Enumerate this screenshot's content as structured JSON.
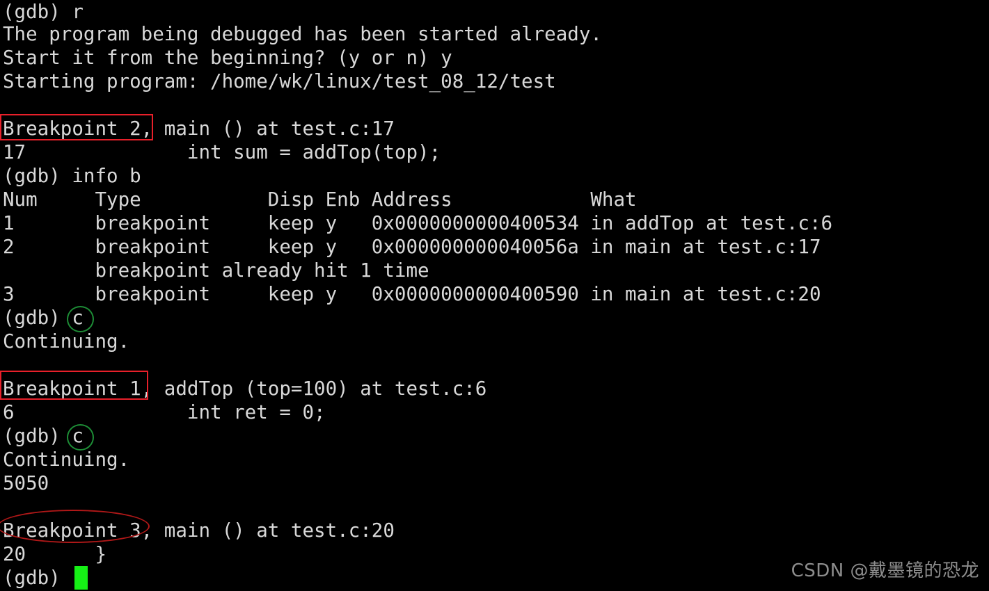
{
  "terminal": {
    "background_color": "#000000",
    "text_color": "#d8d8d8",
    "cursor_color": "#16f016",
    "lines": [
      "(gdb) r",
      "The program being debugged has been started already.",
      "Start it from the beginning? (y or n) y",
      "Starting program: /home/wk/linux/test_08_12/test",
      "",
      "Breakpoint 2, main () at test.c:17",
      "17              int sum = addTop(top);",
      "(gdb) info b",
      "Num     Type           Disp Enb Address            What",
      "1       breakpoint     keep y   0x0000000000400534 in addTop at test.c:6",
      "2       breakpoint     keep y   0x000000000040056a in main at test.c:17",
      "        breakpoint already hit 1 time",
      "3       breakpoint     keep y   0x0000000000400590 in main at test.c:20",
      "(gdb) c",
      "Continuing.",
      "",
      "Breakpoint 1, addTop (top=100) at test.c:6",
      "6               int ret = 0;",
      "(gdb) c",
      "Continuing.",
      "5050",
      "",
      "Breakpoint 3, main () at test.c:20",
      "20      }",
      "(gdb) "
    ]
  },
  "annotations": {
    "red_box_breakpoint2": {
      "label": "Breakpoint 2,",
      "color": "#e8202a"
    },
    "red_box_breakpoint1": {
      "label": "Breakpoint 1",
      "color": "#e8202a"
    },
    "red_ellipse_breakpoint3": {
      "label": "Breakpoint 3",
      "color": "#b01818"
    },
    "green_circle_continue_first": {
      "label": "c",
      "color": "#1d8d36"
    },
    "green_circle_continue_second": {
      "label": "c",
      "color": "#1d8d36"
    }
  },
  "watermark": {
    "text": "CSDN @戴墨镜的恐龙",
    "color": "#8d8d8d"
  }
}
